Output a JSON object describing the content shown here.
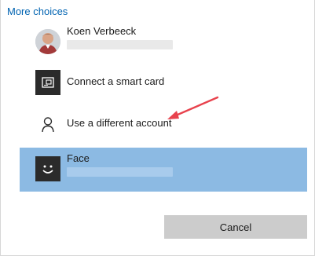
{
  "header": {
    "title": "More choices"
  },
  "options": [
    {
      "title": "Koen Verbeeck",
      "icon": "user-avatar-icon"
    },
    {
      "title": "Connect a smart card",
      "icon": "smart-card-icon"
    },
    {
      "title": "Use a different account",
      "icon": "person-outline-icon"
    },
    {
      "title": "Face",
      "icon": "face-icon",
      "selected": true
    }
  ],
  "footer": {
    "cancel_label": "Cancel"
  },
  "colors": {
    "link": "#0063b1",
    "selected_background": "#8cbae3",
    "annotation_arrow": "#e8424d"
  }
}
